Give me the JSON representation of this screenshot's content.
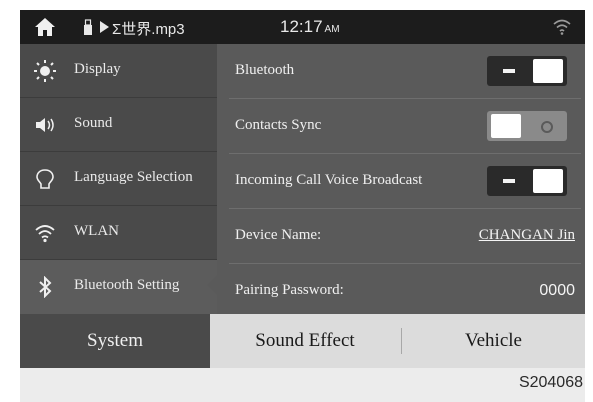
{
  "status_bar": {
    "track": "Σ世界.mp3",
    "time": "12:17",
    "time_suffix": "AM"
  },
  "sidebar": {
    "items": [
      {
        "label": "Display",
        "icon": "sun-icon"
      },
      {
        "label": "Sound",
        "icon": "speaker-icon"
      },
      {
        "label": "Language Selection",
        "icon": "language-icon"
      },
      {
        "label": "WLAN",
        "icon": "wifi-icon"
      },
      {
        "label": "Bluetooth Setting",
        "icon": "bluetooth-icon",
        "active": true
      }
    ]
  },
  "bluetooth_settings": {
    "bluetooth": {
      "label": "Bluetooth",
      "state": "on"
    },
    "contacts_sync": {
      "label": "Contacts Sync",
      "state": "off"
    },
    "incoming_call": {
      "label": "Incoming Call Voice Broadcast",
      "state": "on"
    },
    "device_name": {
      "label": "Device Name:",
      "value": "CHANGAN Jin"
    },
    "pairing_password": {
      "label": "Pairing Password:",
      "value": "0000"
    }
  },
  "tabs": [
    {
      "label": "System",
      "active": true
    },
    {
      "label": "Sound Effect",
      "active": false
    },
    {
      "label": "Vehicle",
      "active": false
    }
  ],
  "caption": "S204068",
  "colors": {
    "screen_bg": "#3a3a3a",
    "status_bar": "#1c1c1c",
    "sidebar_bg": "#4a4a4a",
    "panel_bg": "#5a5a5a",
    "tab_bar": "#dcdcdc"
  }
}
